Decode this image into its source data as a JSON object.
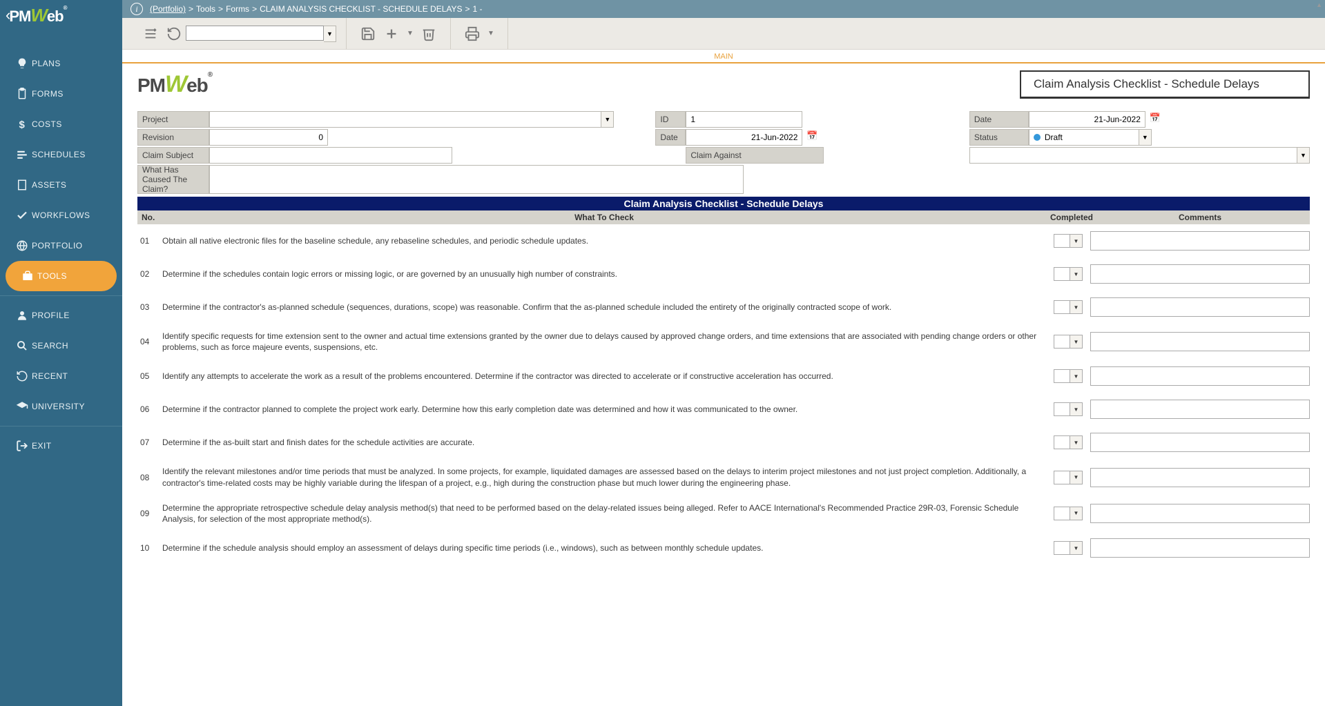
{
  "brand": "PMWeb",
  "breadcrumb": {
    "root": "(Portfolio)",
    "parts": [
      "Tools",
      "Forms",
      "CLAIM ANALYSIS CHECKLIST - SCHEDULE DELAYS",
      "1 -"
    ]
  },
  "sidebar": {
    "items": [
      {
        "label": "PLANS",
        "icon": "lightbulb"
      },
      {
        "label": "FORMS",
        "icon": "clipboard"
      },
      {
        "label": "COSTS",
        "icon": "dollar"
      },
      {
        "label": "SCHEDULES",
        "icon": "bars"
      },
      {
        "label": "ASSETS",
        "icon": "building"
      },
      {
        "label": "WORKFLOWS",
        "icon": "check"
      },
      {
        "label": "PORTFOLIO",
        "icon": "globe"
      },
      {
        "label": "TOOLS",
        "icon": "briefcase",
        "active": true
      },
      {
        "label": "PROFILE",
        "icon": "user",
        "divider": true
      },
      {
        "label": "SEARCH",
        "icon": "search"
      },
      {
        "label": "RECENT",
        "icon": "history"
      },
      {
        "label": "UNIVERSITY",
        "icon": "gradcap"
      },
      {
        "label": "EXIT",
        "icon": "exit",
        "divider": true
      }
    ]
  },
  "toolbar": {
    "select_value": ""
  },
  "tab": {
    "main": "MAIN"
  },
  "form": {
    "title": "Claim Analysis Checklist - Schedule Delays",
    "labels": {
      "project": "Project",
      "id": "ID",
      "date": "Date",
      "revision": "Revision",
      "date2": "Date",
      "status": "Status",
      "claim_subject": "Claim Subject",
      "claim_against": "Claim Against",
      "what_caused": "What Has Caused The Claim?"
    },
    "values": {
      "project": "",
      "id": "1",
      "date": "21-Jun-2022",
      "revision": "0",
      "date2": "21-Jun-2022",
      "status": "Draft",
      "claim_subject": "",
      "claim_against": "",
      "what_caused": ""
    }
  },
  "checklist": {
    "title": "Claim Analysis Checklist - Schedule Delays",
    "headers": {
      "no": "No.",
      "what": "What To Check",
      "completed": "Completed",
      "comments": "Comments"
    },
    "rows": [
      {
        "no": "01",
        "what": "Obtain all native electronic files for the baseline schedule, any rebaseline schedules, and periodic schedule updates."
      },
      {
        "no": "02",
        "what": "Determine if the schedules contain logic errors or missing logic, or are governed by an unusually high number of constraints."
      },
      {
        "no": "03",
        "what": "Determine if the contractor's as-planned schedule (sequences, durations, scope) was reasonable. Confirm that the as-planned schedule included the entirety of the originally contracted scope of work."
      },
      {
        "no": "04",
        "what": "Identify specific requests for time extension sent to the owner and actual time extensions granted by the owner due to delays caused by approved change orders, and time extensions that are associated with pending change orders or other problems, such as force majeure events, suspensions, etc."
      },
      {
        "no": "05",
        "what": "Identify any attempts to accelerate the work as a result of the problems encountered. Determine if the contractor was directed to accelerate or if constructive acceleration has occurred."
      },
      {
        "no": "06",
        "what": "Determine if the contractor planned to complete the project work early. Determine how this early completion date was determined and how it was communicated to the owner."
      },
      {
        "no": "07",
        "what": "Determine if the as-built start and finish dates for the schedule activities are accurate."
      },
      {
        "no": "08",
        "what": "Identify the relevant milestones and/or time periods that must be analyzed. In some projects, for example, liquidated damages are assessed based on the delays to interim project milestones and not just project completion. Additionally, a contractor's time-related costs may be highly variable during the lifespan of a project, e.g., high during the construction phase but much lower during the engineering phase."
      },
      {
        "no": "09",
        "what": "Determine the appropriate retrospective schedule delay analysis method(s) that need to be performed based on the delay-related issues being alleged. Refer to AACE International's Recommended Practice 29R-03, Forensic Schedule Analysis, for selection of the most appropriate method(s)."
      },
      {
        "no": "10",
        "what": "Determine if the schedule analysis should employ an assessment of delays during specific time periods (i.e., windows), such as between monthly schedule updates."
      }
    ]
  }
}
